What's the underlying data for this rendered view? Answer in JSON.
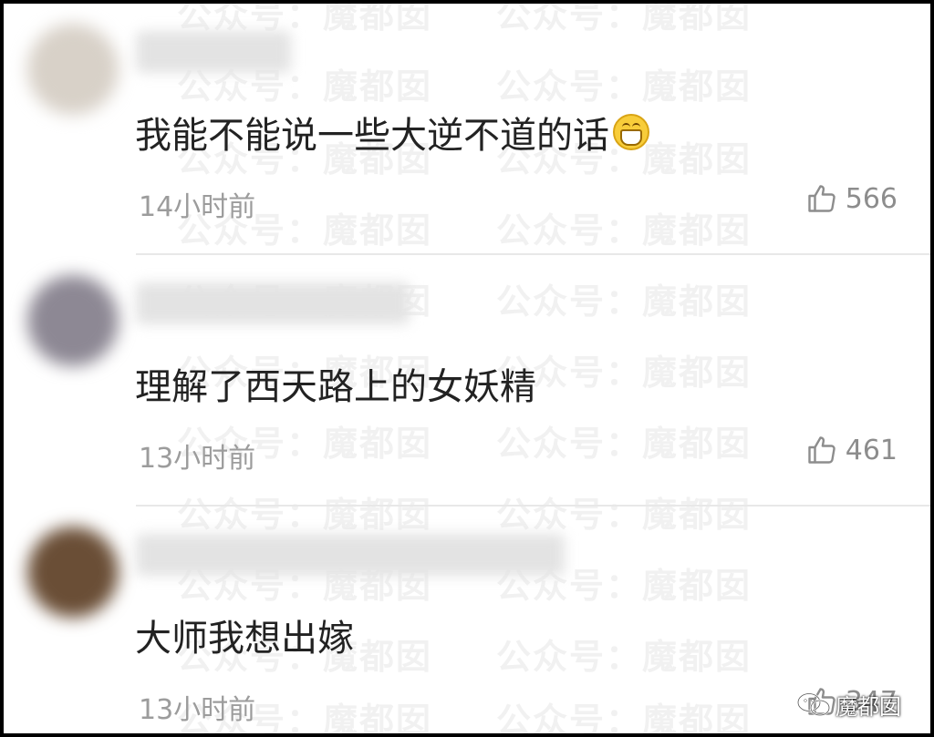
{
  "watermark": "公众号：魔都囡",
  "comments": [
    {
      "text": "我能不能说一些大逆不道的话",
      "emoji": "grin-icon",
      "time": "14小时前",
      "likes": "566",
      "avatar_color": "#d8d1c8"
    },
    {
      "text": "理解了西天路上的女妖精",
      "time": "13小时前",
      "likes": "461",
      "avatar_color": "#8d8894"
    },
    {
      "text": "大师我想出嫁",
      "time": "13小时前",
      "likes": "347",
      "avatar_color": "#6a4e36"
    }
  ],
  "footer": {
    "account": "魔都囡",
    "icon": "wechat-icon"
  },
  "colors": {
    "text": "#222222",
    "meta": "#9c9c9c",
    "divider": "#e8e8e8"
  }
}
